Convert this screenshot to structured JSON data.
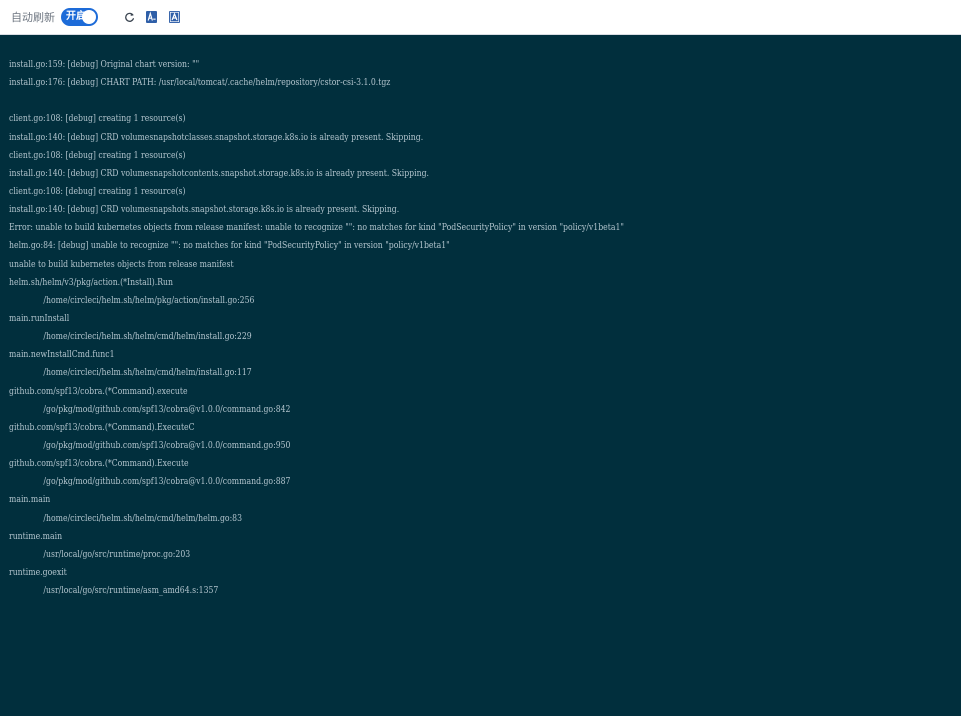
{
  "toolbar": {
    "auto_refresh_label": "自动刷新",
    "toggle_label": "开启",
    "toggle_on": true,
    "icons": [
      "refresh-icon",
      "font-size-decrease-icon",
      "font-size-increase-icon"
    ],
    "accent_color": "#1d6bd8"
  },
  "terminal": {
    "background_color": "#012f3d",
    "text_color": "#b2c4cd",
    "lines": [
      {
        "text": "install.go:159: [debug] Original chart version: \"\"",
        "indent": false
      },
      {
        "text": "install.go:176: [debug] CHART PATH: /usr/local/tomcat/.cache/helm/repository/cstor-csi-3.1.0.tgz",
        "indent": false
      },
      {
        "text": "",
        "indent": false
      },
      {
        "text": "client.go:108: [debug] creating 1 resource(s)",
        "indent": false
      },
      {
        "text": "install.go:140: [debug] CRD volumesnapshotclasses.snapshot.storage.k8s.io is already present. Skipping.",
        "indent": false
      },
      {
        "text": "client.go:108: [debug] creating 1 resource(s)",
        "indent": false
      },
      {
        "text": "install.go:140: [debug] CRD volumesnapshotcontents.snapshot.storage.k8s.io is already present. Skipping.",
        "indent": false
      },
      {
        "text": "client.go:108: [debug] creating 1 resource(s)",
        "indent": false
      },
      {
        "text": "install.go:140: [debug] CRD volumesnapshots.snapshot.storage.k8s.io is already present. Skipping.",
        "indent": false
      },
      {
        "text": "Error: unable to build kubernetes objects from release manifest: unable to recognize \"\": no matches for kind \"PodSecurityPolicy\" in version \"policy/v1beta1\"",
        "indent": false
      },
      {
        "text": "helm.go:84: [debug] unable to recognize \"\": no matches for kind \"PodSecurityPolicy\" in version \"policy/v1beta1\"",
        "indent": false
      },
      {
        "text": "unable to build kubernetes objects from release manifest",
        "indent": false
      },
      {
        "text": "helm.sh/helm/v3/pkg/action.(*Install).Run",
        "indent": false
      },
      {
        "text": "/home/circleci/helm.sh/helm/pkg/action/install.go:256",
        "indent": true
      },
      {
        "text": "main.runInstall",
        "indent": false
      },
      {
        "text": "/home/circleci/helm.sh/helm/cmd/helm/install.go:229",
        "indent": true
      },
      {
        "text": "main.newInstallCmd.func1",
        "indent": false
      },
      {
        "text": "/home/circleci/helm.sh/helm/cmd/helm/install.go:117",
        "indent": true
      },
      {
        "text": "github.com/spf13/cobra.(*Command).execute",
        "indent": false
      },
      {
        "text": "/go/pkg/mod/github.com/spf13/cobra@v1.0.0/command.go:842",
        "indent": true
      },
      {
        "text": "github.com/spf13/cobra.(*Command).ExecuteC",
        "indent": false
      },
      {
        "text": "/go/pkg/mod/github.com/spf13/cobra@v1.0.0/command.go:950",
        "indent": true
      },
      {
        "text": "github.com/spf13/cobra.(*Command).Execute",
        "indent": false
      },
      {
        "text": "/go/pkg/mod/github.com/spf13/cobra@v1.0.0/command.go:887",
        "indent": true
      },
      {
        "text": "main.main",
        "indent": false
      },
      {
        "text": "/home/circleci/helm.sh/helm/cmd/helm/helm.go:83",
        "indent": true
      },
      {
        "text": "runtime.main",
        "indent": false
      },
      {
        "text": "/usr/local/go/src/runtime/proc.go:203",
        "indent": true
      },
      {
        "text": "runtime.goexit",
        "indent": false
      },
      {
        "text": "/usr/local/go/src/runtime/asm_amd64.s:1357",
        "indent": true
      }
    ]
  }
}
